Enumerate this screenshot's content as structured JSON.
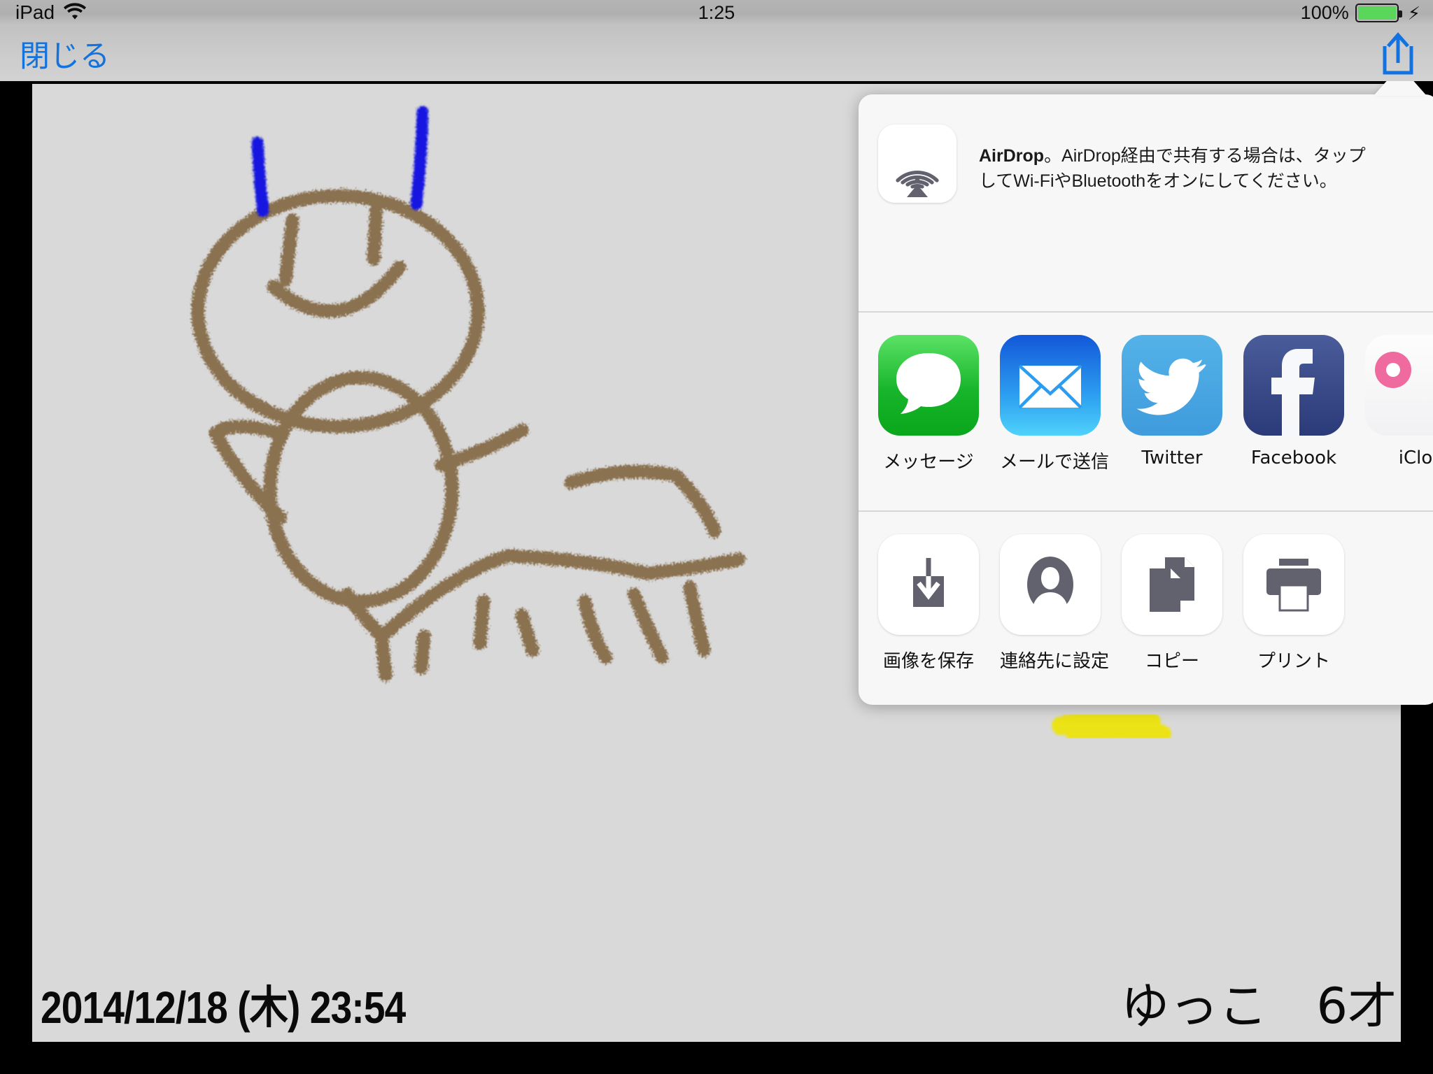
{
  "statusbar": {
    "device_label": "iPad",
    "wifi_icon": "wifi-icon",
    "time": "1:25",
    "battery_percent": "100%",
    "battery_level": 100,
    "charging_icon": "lightning-bolt-icon"
  },
  "navbar": {
    "close_label": "閉じる",
    "share_icon": "share-icon"
  },
  "popover": {
    "airdrop": {
      "icon": "airdrop-icon",
      "text_bold": "AirDrop",
      "text_rest": "。AirDrop経由で共有する場合は、タップしてWi-FiやBluetoothをオンにしてください。",
      "full_text": "AirDrop。AirDrop経由で共有する場合は、タップしてWi-FiやBluetoothをオンにしてください。"
    },
    "apps": [
      {
        "label": "メッセージ",
        "icon": "messages-icon",
        "color": "#17b52b"
      },
      {
        "label": "メールで送信",
        "icon": "mail-icon",
        "color": "#2b9cf0"
      },
      {
        "label": "Twitter",
        "icon": "twitter-bird-icon",
        "color": "#54b2e8"
      },
      {
        "label": "Facebook",
        "icon": "facebook-f-icon",
        "color": "#2b3a78"
      },
      {
        "label": "iClo",
        "icon": "icloud-photo-sharing-icon",
        "color": "#f1f1f3"
      }
    ],
    "actions": [
      {
        "label": "画像を保存",
        "icon": "save-image-download-icon"
      },
      {
        "label": "連絡先に設定",
        "icon": "contact-person-icon"
      },
      {
        "label": "コピー",
        "icon": "copy-documents-icon"
      },
      {
        "label": "プリント",
        "icon": "printer-icon"
      }
    ]
  },
  "canvas": {
    "background_color": "#d9d9d9",
    "caption_date": "2014/12/18 (木) 23:54",
    "caption_name": "ゆっこ　6才",
    "drawing": {
      "title": "child-crayon-drawing-creature",
      "colors": {
        "brown": "#8a7150",
        "blue": "#1414e0",
        "yellow": "#ece319"
      }
    }
  }
}
